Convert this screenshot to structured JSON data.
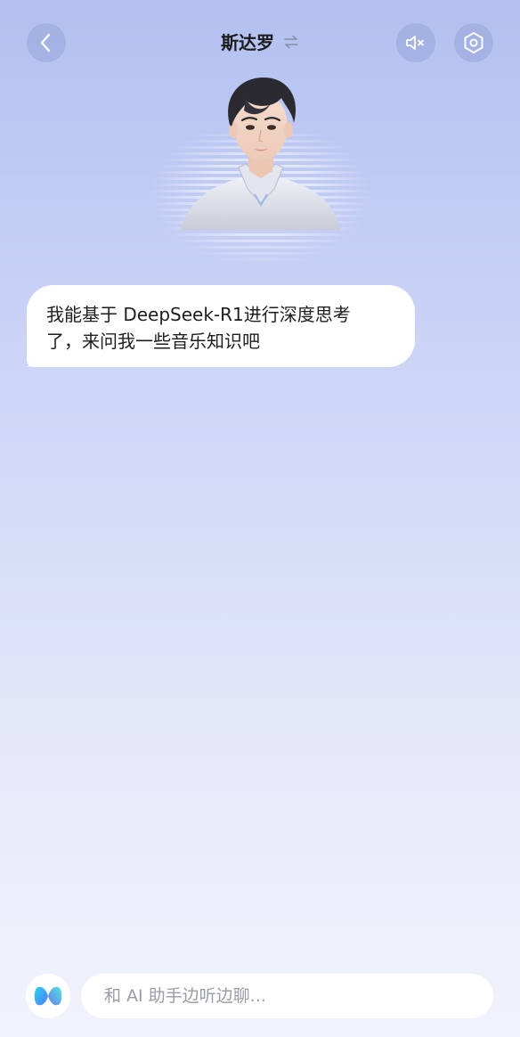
{
  "header": {
    "title": "斯达罗",
    "back_icon": "chevron-left-icon",
    "swap_icon": "swap-arrows-icon",
    "mute_icon": "speaker-muted-icon",
    "settings_icon": "hexagon-settings-icon"
  },
  "avatar": {
    "icon": "virtual-idol-avatar"
  },
  "chat": {
    "messages": [
      {
        "line1": "我能基于 DeepSeek-R1进行深度思考",
        "line2": "了，来问我一些音乐知识吧"
      }
    ]
  },
  "composer": {
    "placeholder": "和 AI 助手边听边聊...",
    "logo_icon": "ai-assistant-logo-icon"
  },
  "colors": {
    "background_top": "#b3c0f0",
    "background_bottom": "#f1f2fc",
    "button_bg": "#96a5d7",
    "bubble_bg": "#ffffff"
  }
}
